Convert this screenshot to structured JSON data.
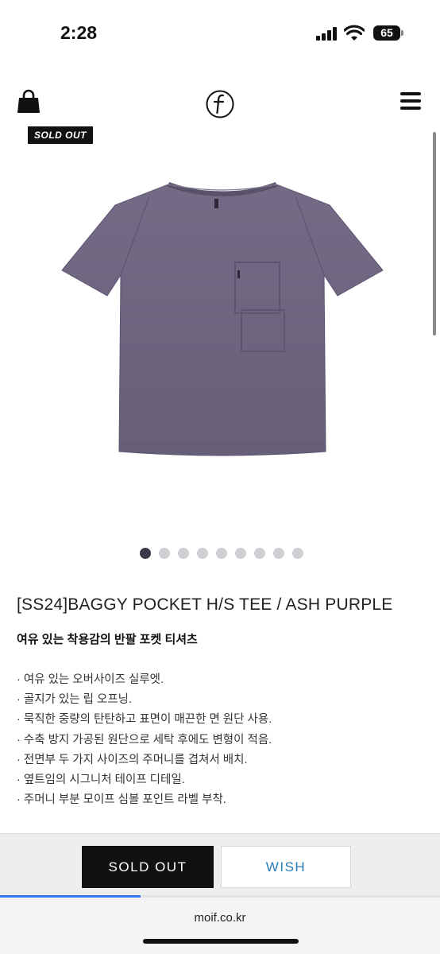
{
  "status_bar": {
    "time": "2:28",
    "battery": "65"
  },
  "header": {
    "left_icon": "shopping-bag-icon",
    "logo_icon": "brand-logo-icon",
    "right_icon": "hamburger-menu-icon"
  },
  "badge": {
    "label": "SOLD OUT"
  },
  "gallery": {
    "image": "ash-purple-tshirt",
    "total_slides": 9,
    "active_slide": 1
  },
  "product": {
    "title": "[SS24]BAGGY POCKET H/S TEE / ASH PURPLE",
    "subtitle": "여유 있는 착용감의 반팔 포켓 티셔츠",
    "features": [
      "· 여유 있는 오버사이즈 실루엣.",
      "· 골지가 있는 립 오프닝.",
      "· 묵직한 중량의 탄탄하고 표면이 매끈한 면 원단 사용.",
      "· 수축 방지 가공된 원단으로 세탁 후에도 변형이 적음.",
      "· 전면부 두 가지 사이즈의 주머니를 겹쳐서 배치.",
      "· 옆트임의 시그니처 테이프 디테일.",
      "· 주머니 부분 모이프 심볼 포인트 라벨 부착."
    ]
  },
  "actions": {
    "sold_out_label": "SOLD OUT",
    "wish_label": "WISH"
  },
  "browser": {
    "url": "moif.co.kr",
    "load_progress": 0.32
  },
  "colors": {
    "accent_blue": "#2a7db8",
    "shirt_purple": "#6f6680",
    "button_dark": "#111111"
  }
}
